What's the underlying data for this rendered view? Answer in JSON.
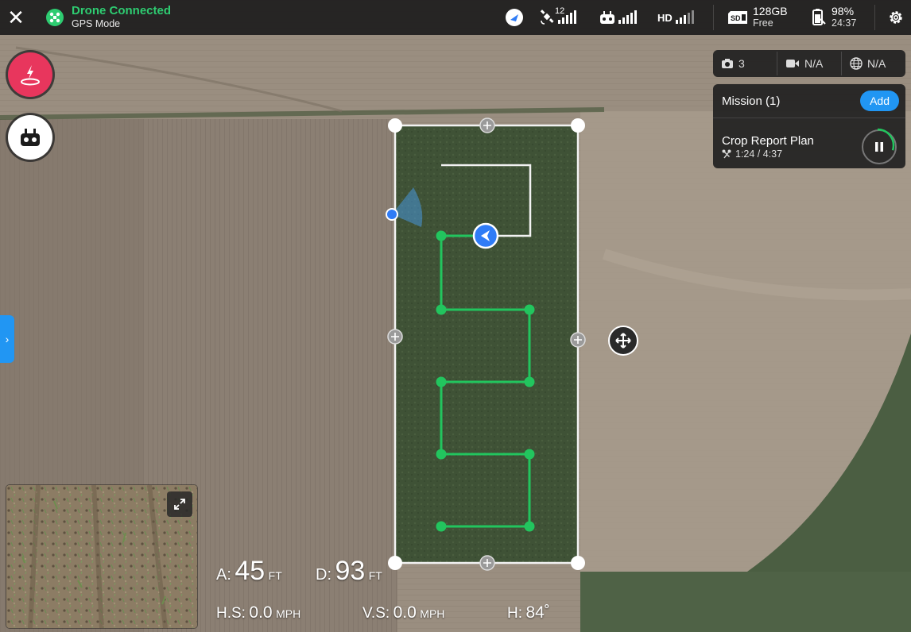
{
  "topbar": {
    "close_label": "✕",
    "connection_title": "Drone Connected",
    "connection_mode": "GPS Mode",
    "satellite_count": "12",
    "video_quality": "HD",
    "storage_size": "128GB",
    "storage_label": "Free",
    "battery_percent": "98%",
    "battery_time": "24:37",
    "colors": {
      "connected": "#2ecc71",
      "bar_bg": "#1c1c1c"
    }
  },
  "left_controls": {
    "takeoff_icon": "landing-icon",
    "remote_icon": "remote-controller-icon",
    "sidebar_toggle": "›"
  },
  "media": {
    "photo_count": "3",
    "video_value": "N/A",
    "globe_value": "N/A"
  },
  "mission": {
    "title": "Mission (1)",
    "add_label": "Add",
    "plan_name": "Crop Report Plan",
    "plan_progress": "1:24 / 4:37",
    "progress_fraction": 0.3
  },
  "telemetry": {
    "altitude_label": "A:",
    "altitude_value": "45",
    "altitude_unit": "FT",
    "distance_label": "D:",
    "distance_value": "93",
    "distance_unit": "FT",
    "hspeed_label": "H.S:",
    "hspeed_value": "0.0",
    "hspeed_unit": "MPH",
    "vspeed_label": "V.S:",
    "vspeed_value": "0.0",
    "vspeed_unit": "MPH",
    "heading_label": "H:",
    "heading_value": "84˚"
  },
  "colors": {
    "accent": "#2196f3",
    "route": "#22c55e",
    "takeoff": "#e8365d"
  }
}
